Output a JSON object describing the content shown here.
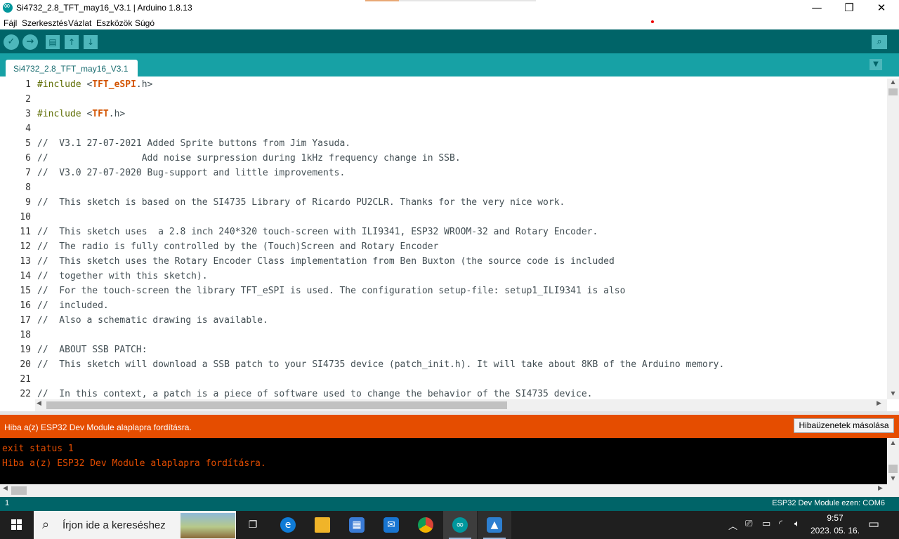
{
  "window": {
    "title": "Si4732_2.8_TFT_may16_V3.1 | Arduino 1.8.13",
    "minimize_glyph": "—",
    "maximize_glyph": "❐",
    "close_glyph": "✕"
  },
  "menu": {
    "items": [
      "Fájl",
      "Szerkesztés",
      "Vázlat",
      "Eszközök",
      "Súgó"
    ]
  },
  "toolbar": {
    "verify_glyph": "✓",
    "upload_glyph": "→",
    "new_glyph": "▤",
    "open_glyph": "↑",
    "save_glyph": "↓",
    "serial_monitor_glyph": "⌕"
  },
  "tabs": {
    "active_label": "Si4732_2.8_TFT_may16_V3.1",
    "menu_glyph": "▼"
  },
  "editor": {
    "lines": [
      {
        "n": "1",
        "parts": [
          [
            "kw",
            "#include "
          ],
          [
            "cm",
            "<"
          ],
          [
            "inc",
            "TFT_eSPI"
          ],
          [
            "cm",
            ".h>"
          ]
        ]
      },
      {
        "n": "2",
        "parts": []
      },
      {
        "n": "3",
        "parts": [
          [
            "kw",
            "#include "
          ],
          [
            "cm",
            "<"
          ],
          [
            "inc",
            "TFT"
          ],
          [
            "cm",
            ".h>"
          ]
        ]
      },
      {
        "n": "4",
        "parts": []
      },
      {
        "n": "5",
        "parts": [
          [
            "cm",
            "//  V3.1 27-07-2021 Added Sprite buttons from Jim Yasuda."
          ]
        ]
      },
      {
        "n": "6",
        "parts": [
          [
            "cm",
            "//                 Add noise surpression during 1kHz frequency change in SSB."
          ]
        ]
      },
      {
        "n": "7",
        "parts": [
          [
            "cm",
            "//  V3.0 27-07-2020 Bug-support and little improvements."
          ]
        ]
      },
      {
        "n": "8",
        "parts": []
      },
      {
        "n": "9",
        "parts": [
          [
            "cm",
            "//  This sketch is based on the SI4735 Library of Ricardo PU2CLR. Thanks for the very nice work."
          ]
        ]
      },
      {
        "n": "10",
        "parts": []
      },
      {
        "n": "11",
        "parts": [
          [
            "cm",
            "//  This sketch uses  a 2.8 inch 240*320 touch-screen with ILI9341, ESP32 WROOM-32 and Rotary Encoder."
          ]
        ]
      },
      {
        "n": "12",
        "parts": [
          [
            "cm",
            "//  The radio is fully controlled by the (Touch)Screen and Rotary Encoder"
          ]
        ]
      },
      {
        "n": "13",
        "parts": [
          [
            "cm",
            "//  This sketch uses the Rotary Encoder Class implementation from Ben Buxton (the source code is included"
          ]
        ]
      },
      {
        "n": "14",
        "parts": [
          [
            "cm",
            "//  together with this sketch)."
          ]
        ]
      },
      {
        "n": "15",
        "parts": [
          [
            "cm",
            "//  For the touch-screen the library TFT_eSPI is used. The configuration setup-file: setup1_ILI9341 is also"
          ]
        ]
      },
      {
        "n": "16",
        "parts": [
          [
            "cm",
            "//  included."
          ]
        ]
      },
      {
        "n": "17",
        "parts": [
          [
            "cm",
            "//  Also a schematic drawing is available."
          ]
        ]
      },
      {
        "n": "18",
        "parts": []
      },
      {
        "n": "19",
        "parts": [
          [
            "cm",
            "//  ABOUT SSB PATCH:"
          ]
        ]
      },
      {
        "n": "20",
        "parts": [
          [
            "cm",
            "//  This sketch will download a SSB patch to your SI4735 device (patch_init.h). It will take about 8KB of the Arduino memory."
          ]
        ]
      },
      {
        "n": "21",
        "parts": []
      },
      {
        "n": "22",
        "parts": [
          [
            "cm",
            "//  In this context, a patch is a piece of software used to change the behavior of the SI4735 device."
          ]
        ]
      }
    ]
  },
  "status": {
    "error_message": "Hiba a(z) ESP32 Dev Module alaplapra fordításra.",
    "copy_errors_label": "Hibaüzenetek másolása"
  },
  "console": {
    "lines": [
      "exit status 1",
      "Hiba a(z) ESP32 Dev Module alaplapra fordításra."
    ]
  },
  "statusbar": {
    "line_number": "1",
    "board_port": "ESP32 Dev Module ezen: COM6"
  },
  "taskbar": {
    "search_placeholder": "Írjon ide a kereséshez",
    "clock_time": "9:57",
    "clock_date": "2023. 05. 16."
  },
  "colors": {
    "teal_dark": "#006468",
    "teal_tab": "#17a1a5",
    "error_orange": "#e54d00",
    "console_text": "#e34c00"
  }
}
